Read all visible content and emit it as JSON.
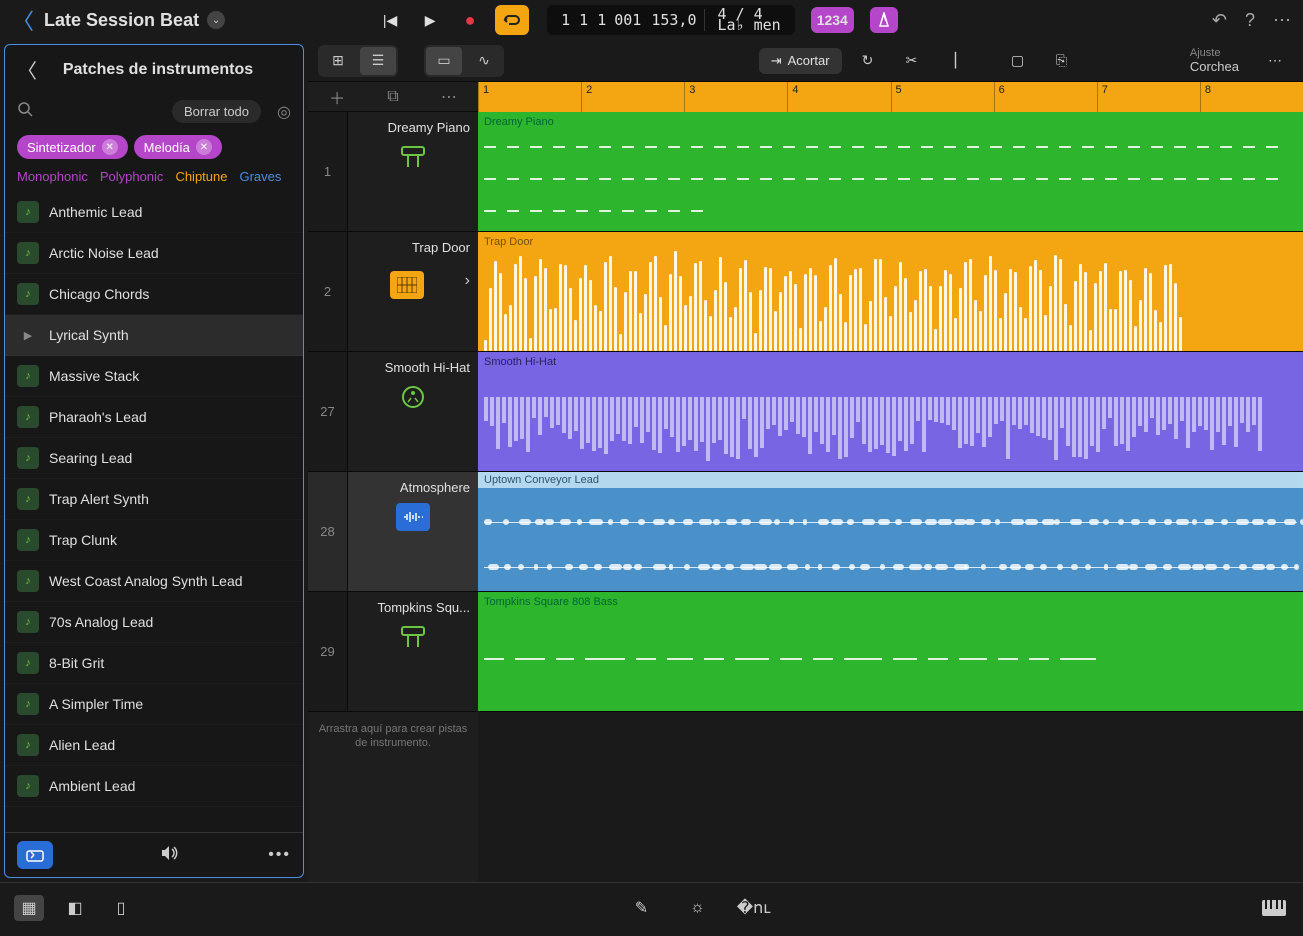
{
  "header": {
    "project_title": "Late Session Beat",
    "lcd": {
      "bars": "1 1 1",
      "ticks": "001",
      "tempo": "153,0",
      "time_sig": "4 / 4",
      "key": "La♭ men"
    },
    "count_badge": "1234",
    "snap": {
      "label": "Ajuste",
      "value": "Corchea"
    },
    "shorten": "Acortar"
  },
  "sidebar": {
    "title": "Patches de instrumentos",
    "clear_all": "Borrar todo",
    "tags": [
      "Sintetizador",
      "Melodía"
    ],
    "subtags": [
      "Monophonic",
      "Polyphonic",
      "Chiptune",
      "Graves"
    ],
    "patches": [
      "Anthemic Lead",
      "Arctic Noise Lead",
      "Chicago Chords",
      "Lyrical Synth",
      "Massive Stack",
      "Pharaoh's Lead",
      "Searing Lead",
      "Trap Alert Synth",
      "Trap Clunk",
      "West Coast Analog Synth Lead",
      "70s Analog Lead",
      "8-Bit Grit",
      "A Simpler Time",
      "Alien Lead",
      "Ambient Lead"
    ]
  },
  "tracks": [
    {
      "num": "1",
      "name": "Dreamy Piano",
      "region": "Dreamy Piano",
      "icon": "piano",
      "color": "green"
    },
    {
      "num": "2",
      "name": "Trap Door",
      "region": "Trap Door",
      "icon": "grid",
      "color": "yellow"
    },
    {
      "num": "27",
      "name": "Smooth Hi-Hat",
      "region": "Smooth Hi-Hat",
      "icon": "drum",
      "color": "purple"
    },
    {
      "num": "28",
      "name": "Atmosphere",
      "region": "Uptown Conveyor Lead",
      "icon": "wave",
      "color": "blue"
    },
    {
      "num": "29",
      "name": "Tompkins Squ...",
      "region": "Tompkins Square 808 Bass",
      "icon": "piano",
      "color": "green"
    }
  ],
  "drag_hint": "Arrastra aquí para crear pistas de instrumento.",
  "ruler": [
    "1",
    "2",
    "3",
    "4",
    "5",
    "6",
    "7",
    "8"
  ]
}
